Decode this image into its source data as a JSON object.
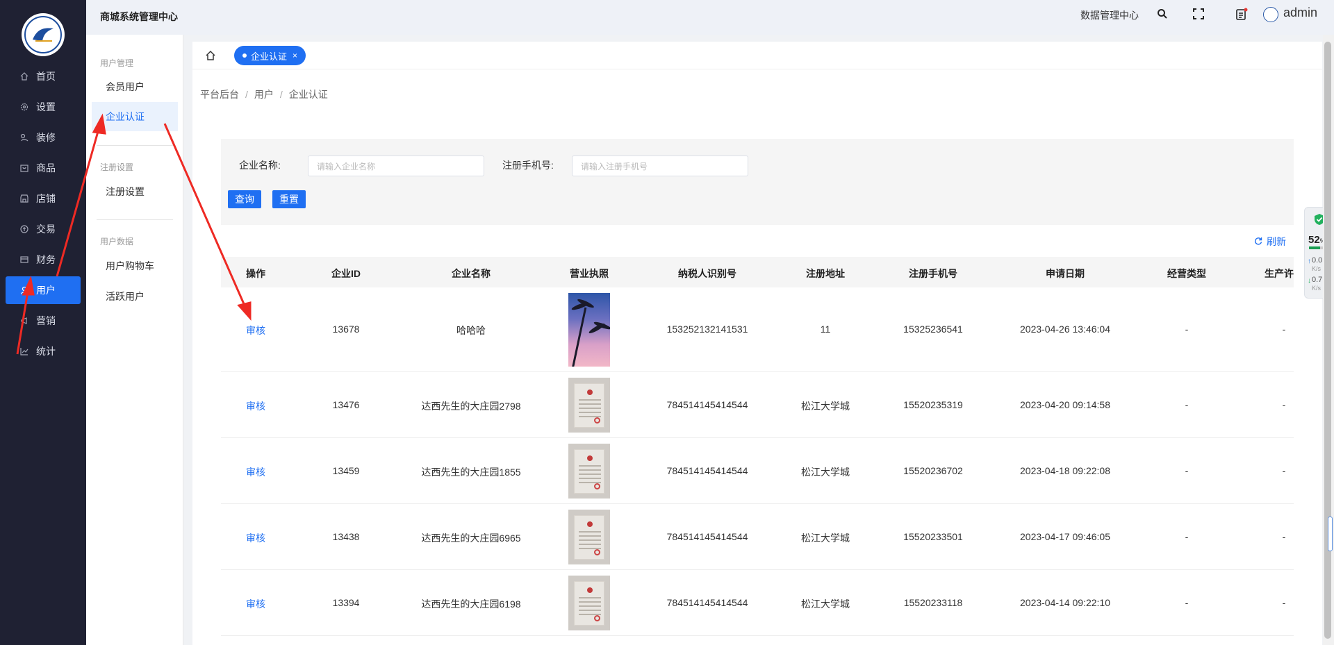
{
  "app": {
    "title": "商城系统管理中心",
    "data_center_label": "数据管理中心",
    "user_name": "admin"
  },
  "sidebar": {
    "items": [
      {
        "label": "首页",
        "icon": "home-icon"
      },
      {
        "label": "设置",
        "icon": "gear-icon"
      },
      {
        "label": "装修",
        "icon": "decorate-icon"
      },
      {
        "label": "商品",
        "icon": "goods-icon"
      },
      {
        "label": "店铺",
        "icon": "store-icon"
      },
      {
        "label": "交易",
        "icon": "trade-icon"
      },
      {
        "label": "财务",
        "icon": "finance-icon"
      },
      {
        "label": "用户",
        "icon": "user-icon",
        "active": true
      },
      {
        "label": "营销",
        "icon": "marketing-icon"
      },
      {
        "label": "统计",
        "icon": "chart-icon"
      }
    ]
  },
  "subnav": {
    "groups": [
      {
        "title": "用户管理",
        "items": [
          "会员用户",
          "企业认证"
        ]
      },
      {
        "title": "注册设置",
        "items": [
          "注册设置"
        ]
      },
      {
        "title": "用户数据",
        "items": [
          "用户购物车",
          "活跃用户"
        ]
      }
    ],
    "active_item": "企业认证"
  },
  "tabs": {
    "active_tab_label": "企业认证",
    "close_glyph": "×"
  },
  "breadcrumb": [
    "平台后台",
    "用户",
    "企业认证"
  ],
  "filter": {
    "company_name_label": "企业名称:",
    "company_name_placeholder": "请输入企业名称",
    "phone_label": "注册手机号:",
    "phone_placeholder": "请输入注册手机号",
    "query_button": "查询",
    "reset_button": "重置"
  },
  "refresh_label": "刷新",
  "table": {
    "columns": [
      "操作",
      "企业ID",
      "企业名称",
      "营业执照",
      "纳税人识别号",
      "注册地址",
      "注册手机号",
      "申请日期",
      "经营类型",
      "生产许可"
    ],
    "rows": [
      {
        "action": "审核",
        "id": "13678",
        "name": "哈哈哈",
        "license": "palm",
        "tax_id": "153252132141531",
        "address": "11",
        "phone": "15325236541",
        "date": "2023-04-26 13:46:04",
        "biz_type": "-",
        "permit": "-"
      },
      {
        "action": "审核",
        "id": "13476",
        "name": "达西先生的大庄园2798",
        "license": "cert",
        "tax_id": "784514145414544",
        "address": "松江大学城",
        "phone": "15520235319",
        "date": "2023-04-20 09:14:58",
        "biz_type": "-",
        "permit": "-"
      },
      {
        "action": "审核",
        "id": "13459",
        "name": "达西先生的大庄园1855",
        "license": "cert",
        "tax_id": "784514145414544",
        "address": "松江大学城",
        "phone": "15520236702",
        "date": "2023-04-18 09:22:08",
        "biz_type": "-",
        "permit": "-"
      },
      {
        "action": "审核",
        "id": "13438",
        "name": "达西先生的大庄园6965",
        "license": "cert",
        "tax_id": "784514145414544",
        "address": "松江大学城",
        "phone": "15520233501",
        "date": "2023-04-17 09:46:05",
        "biz_type": "-",
        "permit": "-"
      },
      {
        "action": "审核",
        "id": "13394",
        "name": "达西先生的大庄园6198",
        "license": "cert",
        "tax_id": "784514145414544",
        "address": "松江大学城",
        "phone": "15520233118",
        "date": "2023-04-14 09:22:10",
        "biz_type": "-",
        "permit": "-"
      }
    ]
  },
  "widget": {
    "percent": "52",
    "percent_unit": "%",
    "percent_value": 52,
    "upload_speed": "0.0",
    "download_speed": "0.7",
    "speed_unit": "K/s"
  },
  "colors": {
    "sidebar_bg": "#1f2133",
    "accent": "#1f6ff2",
    "annotation": "#ee2a24"
  }
}
